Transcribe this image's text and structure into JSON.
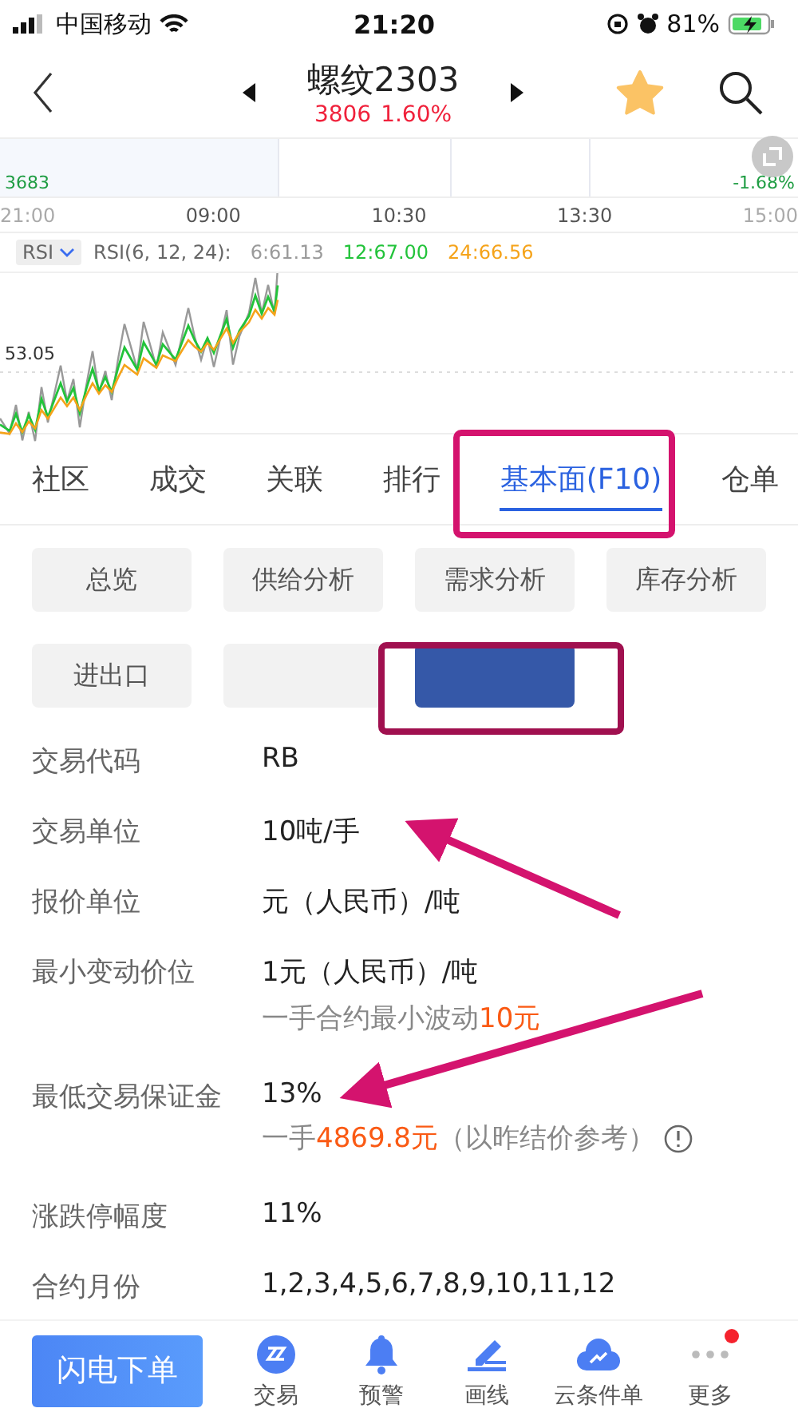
{
  "status_bar": {
    "carrier": "中国移动",
    "time": "21:20",
    "battery": "81%"
  },
  "header": {
    "title": "螺纹2303",
    "price": "3806",
    "change": "1.60%"
  },
  "price_chart": {
    "low_price": "3683",
    "low_change": "-1.68%",
    "times": [
      "21:00",
      "09:00",
      "10:30",
      "13:30",
      "15:00"
    ]
  },
  "rsi": {
    "selector": "RSI",
    "label": "RSI(6, 12, 24):",
    "mid_label": "53.05",
    "values": [
      {
        "text": "6:61.13",
        "color": "#9a9a9a"
      },
      {
        "text": "12:67.00",
        "color": "#22c33a"
      },
      {
        "text": "24:66.56",
        "color": "#f5a31a"
      }
    ]
  },
  "tabs": [
    {
      "label": "社区",
      "selected": false
    },
    {
      "label": "成交",
      "selected": false
    },
    {
      "label": "关联",
      "selected": false
    },
    {
      "label": "排行",
      "selected": false
    },
    {
      "label": "基本面(F10)",
      "selected": true
    },
    {
      "label": "仓单",
      "selected": false
    }
  ],
  "sections": [
    {
      "label": "总览",
      "selected": false
    },
    {
      "label": "供给分析",
      "selected": false
    },
    {
      "label": "需求分析",
      "selected": false
    },
    {
      "label": "库存分析",
      "selected": false
    },
    {
      "label": "进出口",
      "selected": false
    },
    {
      "selected": false
    },
    {
      "selected": true
    }
  ],
  "fields": [
    {
      "label": "交易代码",
      "value": "RB"
    },
    {
      "label": "交易单位",
      "value": "10吨/手"
    },
    {
      "label": "报价单位",
      "value": "元（人民币）/吨"
    },
    {
      "label": "最小变动价位",
      "value": "1元（人民币）/吨",
      "note": [
        {
          "text": "一手合约最小波动",
          "highlight": false
        },
        {
          "text": "10元",
          "highlight": true
        }
      ],
      "info": false
    },
    {
      "label": "最低交易保证金",
      "value": "13%",
      "note": [
        {
          "text": "一手",
          "highlight": false
        },
        {
          "text": "4869.8元",
          "highlight": true
        },
        {
          "text": "（以昨结价参考）",
          "highlight": false
        }
      ],
      "info": true
    },
    {
      "label": "涨跌停幅度",
      "value": "11%"
    },
    {
      "label": "合约月份",
      "value": "1,2,3,4,5,6,7,8,9,10,11,12"
    }
  ],
  "bottom_bar": {
    "order_button": "闪电下单",
    "items": [
      {
        "label": "交易",
        "kind": "trade",
        "badge": false
      },
      {
        "label": "预警",
        "kind": "alert",
        "badge": false
      },
      {
        "label": "画线",
        "kind": "draw",
        "badge": false
      },
      {
        "label": "云条件单",
        "kind": "cloud",
        "badge": false
      },
      {
        "label": "更多",
        "kind": "more",
        "badge": true
      }
    ]
  }
}
